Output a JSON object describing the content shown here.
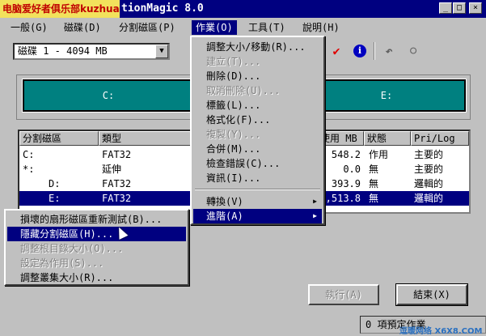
{
  "titlebar": {
    "watermark": "电脑爱好者俱乐部kuzhuai",
    "title": "tionMagic 8.0",
    "minimize": "_",
    "maximize": "□",
    "close": "×"
  },
  "menubar": [
    "一般(G)",
    "磁碟(D)",
    "分割磁區(P)",
    "作業(O)",
    "工具(T)",
    "說明(H)"
  ],
  "disk_select": {
    "value": "磁碟 1 - 4094  MB",
    "arrow": "▼"
  },
  "toolbar_icons": [
    "checkmark-icon",
    "info-icon",
    "undo-icon",
    "circle-icon"
  ],
  "toolbar_glyphs": {
    "check": "✔",
    "info": "i",
    "undo": "↶",
    "circle": "○"
  },
  "partition_map": {
    "c_label": "C:",
    "e_label": "E:"
  },
  "table": {
    "headers": [
      "分割磁區",
      "類型",
      "",
      "使用 MB",
      "狀態",
      "Pri/Log"
    ],
    "rows": [
      {
        "name": "C:",
        "type": "FAT32",
        "used": "548.2",
        "status": "作用",
        "pri": "主要的",
        "selected": false
      },
      {
        "name": "*:",
        "type": "延伸",
        "used": "0.0",
        "status": "無",
        "pri": "主要的",
        "selected": false
      },
      {
        "name": "D:",
        "type": "FAT32",
        "used": "393.9",
        "status": "無",
        "pri": "邏輯的",
        "selected": false
      },
      {
        "name": "E:",
        "type": "FAT32",
        "used": ",513.8",
        "status": "無",
        "pri": "邏輯的",
        "selected": true
      }
    ]
  },
  "operations_menu": {
    "items": [
      {
        "label": "調整大小/移動(R)...",
        "disabled": false
      },
      {
        "label": "建立(T)...",
        "disabled": true
      },
      {
        "label": "刪除(D)...",
        "disabled": false
      },
      {
        "label": "取消刪除(U)...",
        "disabled": true
      },
      {
        "label": "標籤(L)...",
        "disabled": false
      },
      {
        "label": "格式化(F)...",
        "disabled": false
      },
      {
        "label": "複製(Y)...",
        "disabled": true
      },
      {
        "label": "合併(M)...",
        "disabled": false
      },
      {
        "label": "檢查錯誤(C)...",
        "disabled": false
      },
      {
        "label": "資訊(I)...",
        "disabled": false
      }
    ],
    "submenus": [
      {
        "label": "轉換(V)",
        "arrow": "▶"
      },
      {
        "label": "進階(A)",
        "arrow": "▶"
      }
    ]
  },
  "advanced_menu": {
    "items": [
      {
        "label": "損壞的扇形磁區重新測試(B)...",
        "disabled": false
      },
      {
        "label": "隱藏分割磁區(H)...",
        "disabled": false
      },
      {
        "label": "調整根目錄大小(O)...",
        "disabled": true
      },
      {
        "label": "設定為作用(S)...",
        "disabled": true
      },
      {
        "label": "調整叢集大小(R)...",
        "disabled": false
      }
    ]
  },
  "buttons": {
    "apply": "執行(A)",
    "exit": "結束(X)"
  },
  "status": "0 項預定作業",
  "bottom_watermark": "逗暖网络 X6X8.COM",
  "colors": {
    "titlebar": "#000080",
    "partition": "#008080",
    "selection": "#000080"
  }
}
